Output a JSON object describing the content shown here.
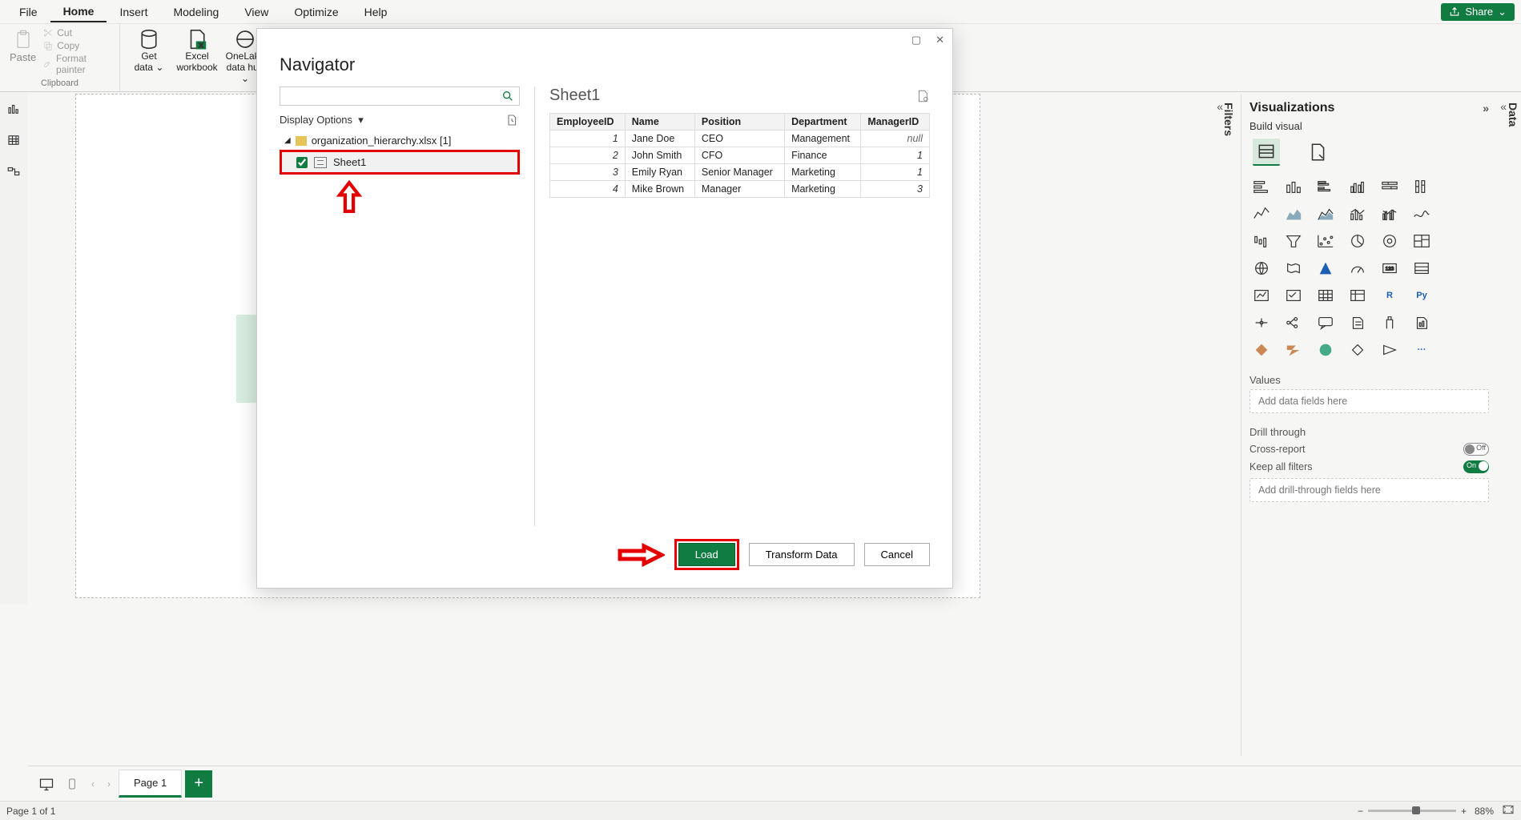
{
  "menu": {
    "file": "File",
    "home": "Home",
    "insert": "Insert",
    "modeling": "Modeling",
    "view": "View",
    "optimize": "Optimize",
    "help": "Help",
    "share": "Share"
  },
  "ribbon": {
    "paste": "Paste",
    "cut": "Cut",
    "copy": "Copy",
    "format_painter": "Format painter",
    "clipboard_caption": "Clipboard",
    "get_data": "Get\ndata",
    "excel_wb": "Excel\nworkbook",
    "onelake": "OneLake\ndata hub"
  },
  "navigator": {
    "title": "Navigator",
    "search_placeholder": "",
    "display_options": "Display Options",
    "file_label": "organization_hierarchy.xlsx [1]",
    "sheet_label": "Sheet1",
    "preview_title": "Sheet1",
    "columns": [
      "EmployeeID",
      "Name",
      "Position",
      "Department",
      "ManagerID"
    ],
    "rows": [
      {
        "EmployeeID": "1",
        "Name": "Jane Doe",
        "Position": "CEO",
        "Department": "Management",
        "ManagerID": "null"
      },
      {
        "EmployeeID": "2",
        "Name": "John Smith",
        "Position": "CFO",
        "Department": "Finance",
        "ManagerID": "1"
      },
      {
        "EmployeeID": "3",
        "Name": "Emily Ryan",
        "Position": "Senior Manager",
        "Department": "Marketing",
        "ManagerID": "1"
      },
      {
        "EmployeeID": "4",
        "Name": "Mike Brown",
        "Position": "Manager",
        "Department": "Marketing",
        "ManagerID": "3"
      }
    ],
    "buttons": {
      "load": "Load",
      "transform": "Transform Data",
      "cancel": "Cancel"
    }
  },
  "vis_pane": {
    "title": "Visualizations",
    "subtitle": "Build visual",
    "values_label": "Values",
    "values_placeholder": "Add data fields here",
    "drill_label": "Drill through",
    "cross_report": "Cross-report",
    "keep_filters": "Keep all filters",
    "drill_placeholder": "Add drill-through fields here",
    "off": "Off",
    "on": "On"
  },
  "side_tabs": {
    "filters": "Filters",
    "data": "Data"
  },
  "page_tabs": {
    "page1": "Page 1"
  },
  "status": {
    "page": "Page 1 of 1",
    "zoom": "88%"
  }
}
